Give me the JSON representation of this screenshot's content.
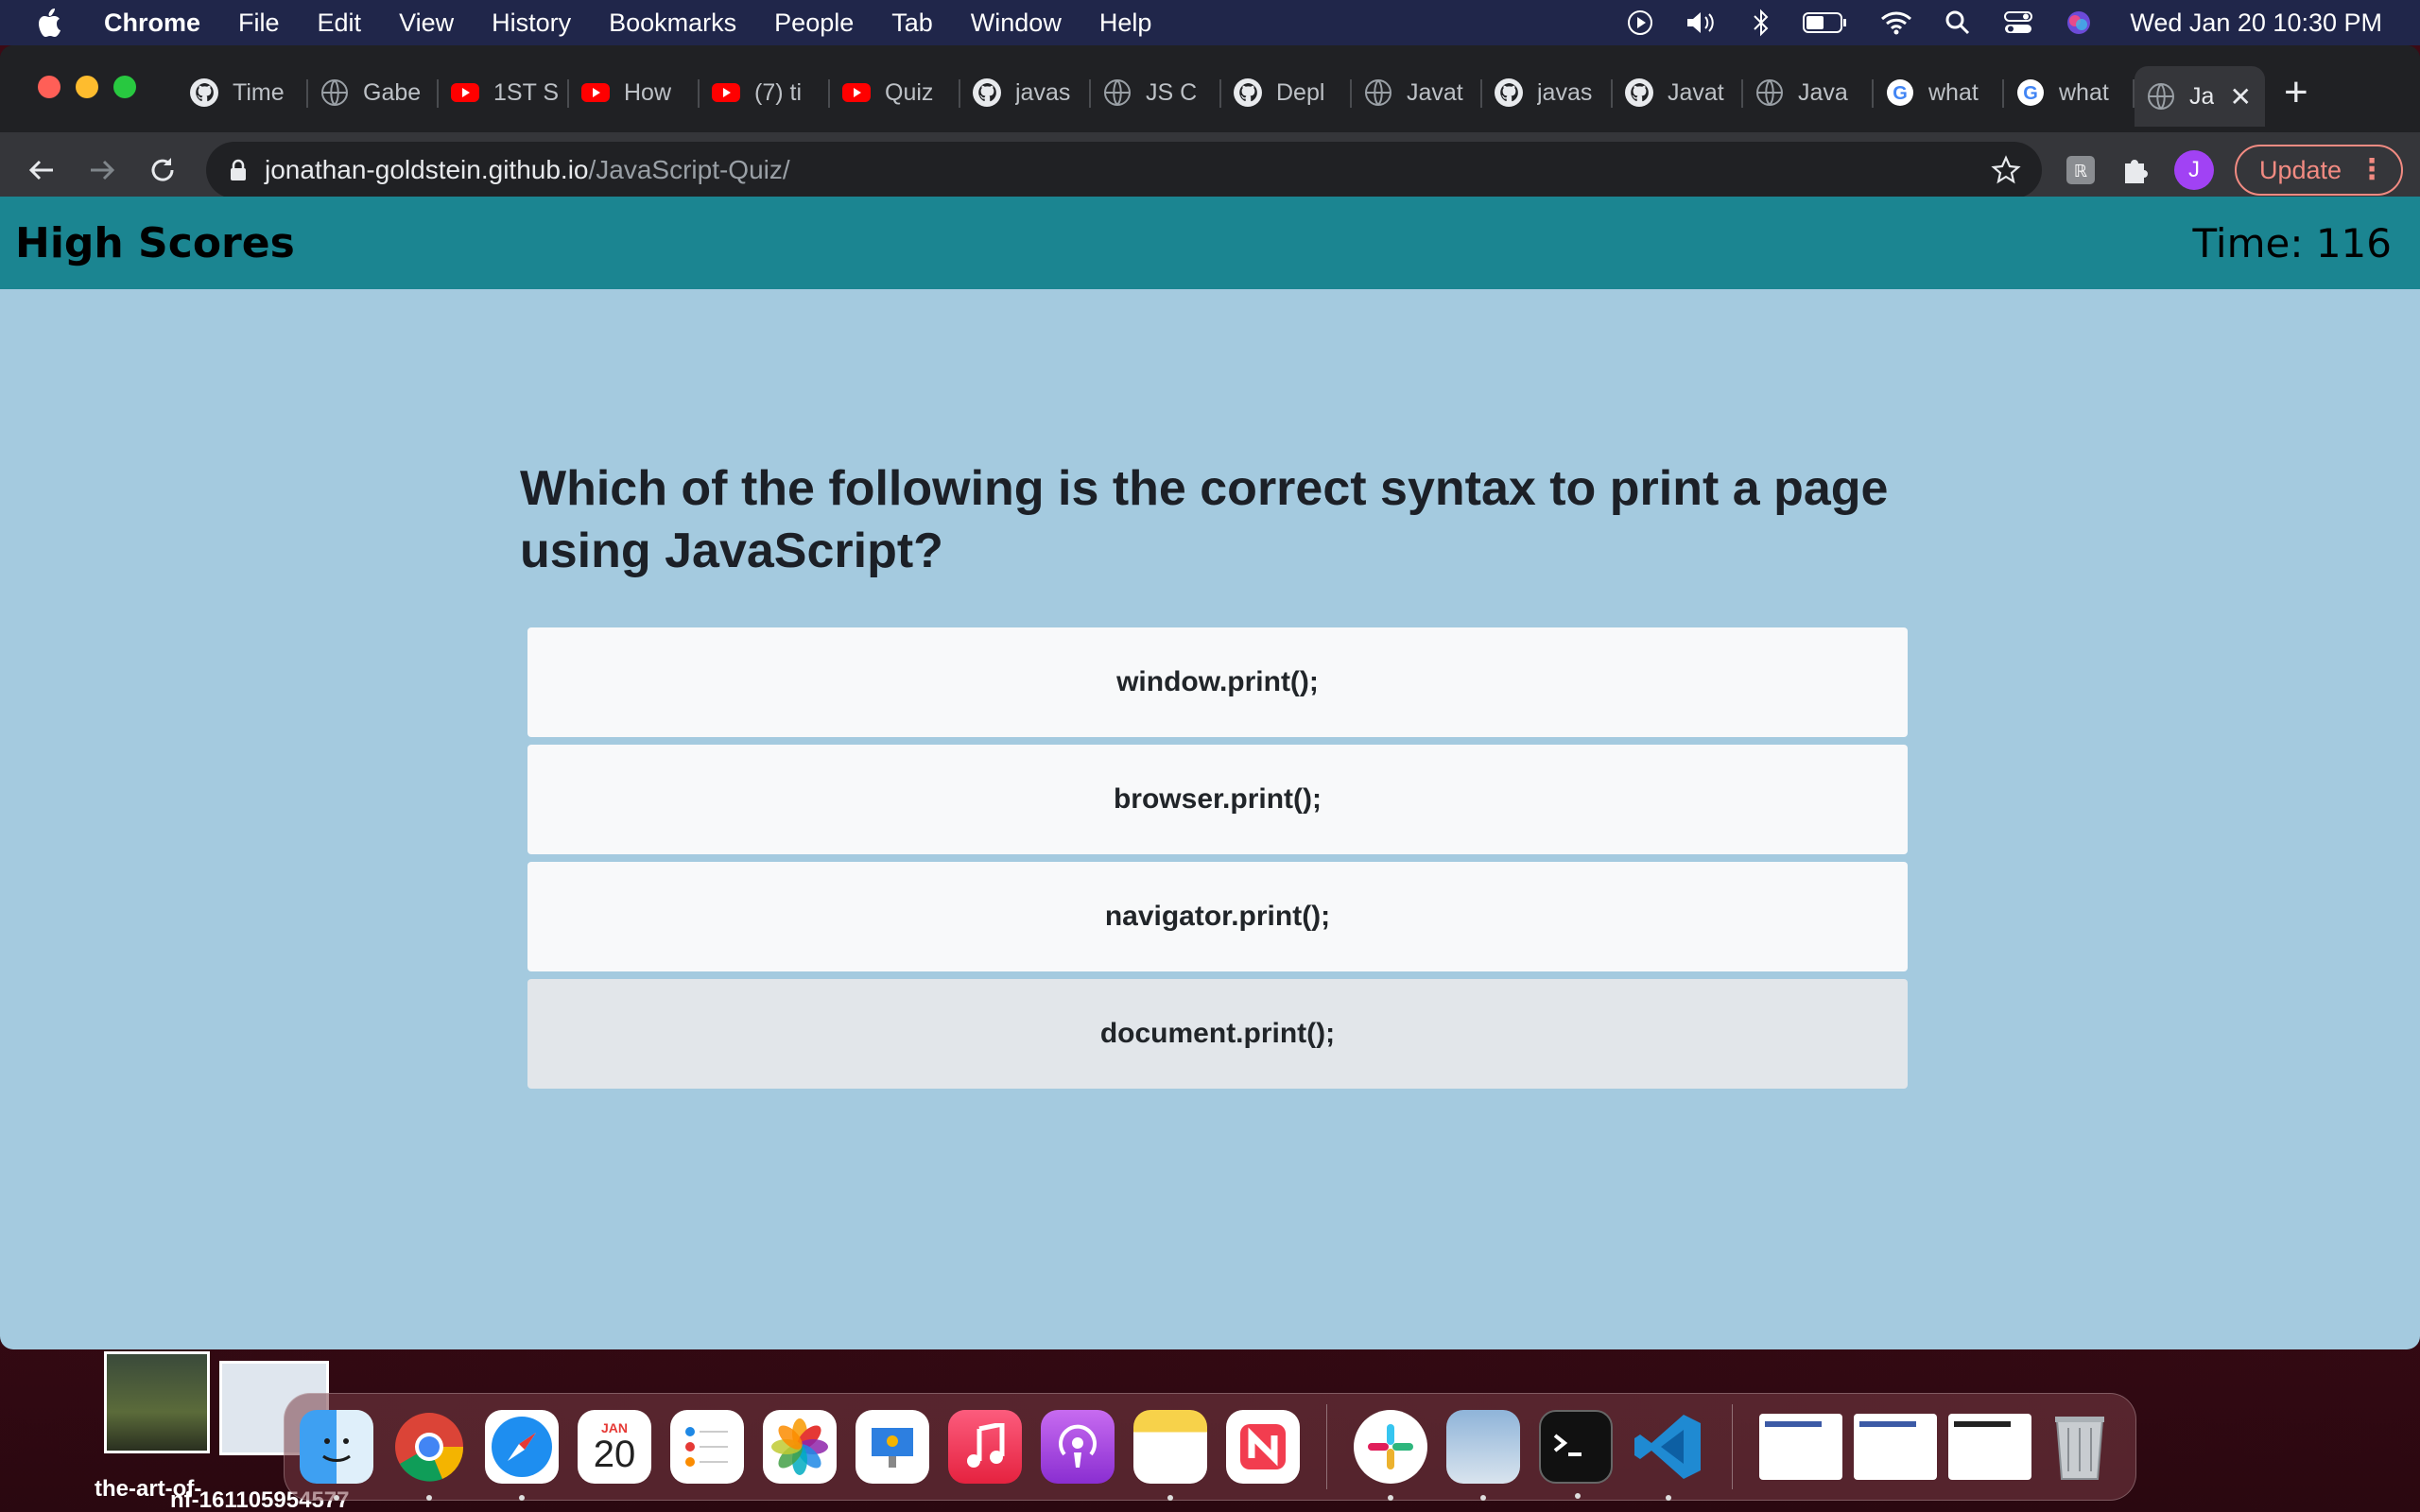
{
  "menubar": {
    "app": "Chrome",
    "items": [
      "File",
      "Edit",
      "View",
      "History",
      "Bookmarks",
      "People",
      "Tab",
      "Window",
      "Help"
    ],
    "clock": "Wed Jan 20  10:30 PM"
  },
  "tabs": [
    {
      "label": "Time",
      "icon": "github-icon"
    },
    {
      "label": "Gabe",
      "icon": "globe-icon"
    },
    {
      "label": "1ST S",
      "icon": "youtube-icon"
    },
    {
      "label": "How",
      "icon": "youtube-icon"
    },
    {
      "label": "(7) ti",
      "icon": "youtube-icon"
    },
    {
      "label": "Quiz",
      "icon": "youtube-icon"
    },
    {
      "label": "javas",
      "icon": "github-icon"
    },
    {
      "label": "JS C",
      "icon": "globe-icon"
    },
    {
      "label": "Depl",
      "icon": "github-icon"
    },
    {
      "label": "Javat",
      "icon": "globe-icon"
    },
    {
      "label": "javas",
      "icon": "github-icon"
    },
    {
      "label": "Javat",
      "icon": "github-icon"
    },
    {
      "label": "Java",
      "icon": "globe-icon"
    },
    {
      "label": "what",
      "icon": "google-icon"
    },
    {
      "label": "what",
      "icon": "google-icon"
    },
    {
      "label": "Ja",
      "icon": "globe-icon",
      "active": true
    }
  ],
  "address": {
    "host": "jonathan-goldstein.github.io",
    "path": "/JavaScript-Quiz/"
  },
  "toolbar": {
    "avatar_letter": "J",
    "update_label": "Update"
  },
  "page": {
    "high_scores": "High Scores",
    "timer": "Time: 116",
    "question": "Which of the following is the correct syntax to print a page using JavaScript?",
    "answers": [
      "window.print();",
      "browser.print();",
      "navigator.print();",
      "document.print();"
    ]
  },
  "desktop": {
    "file1": "the-art-of-",
    "file2": "nf-161105954577"
  },
  "dock": {
    "calendar_month": "JAN",
    "calendar_day": "20"
  },
  "colors": {
    "header": "#1b8591",
    "page_bg": "#a4cadf",
    "answer_bg": "#f8f9fa",
    "answer_hover": "#e2e6ea"
  }
}
